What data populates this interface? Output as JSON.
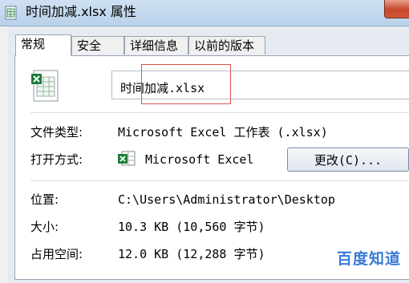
{
  "window": {
    "title": "时间加减.xlsx 属性"
  },
  "tabs": [
    {
      "label": "常规"
    },
    {
      "label": "安全"
    },
    {
      "label": "详细信息"
    },
    {
      "label": "以前的版本"
    }
  ],
  "general": {
    "file_name": "时间加减.xlsx",
    "file_type": {
      "label": "文件类型:",
      "value": "Microsoft Excel 工作表 (.xlsx)"
    },
    "open_with": {
      "label": "打开方式:",
      "value": "Microsoft Excel",
      "change_button": "更改(C)..."
    },
    "location": {
      "label": "位置:",
      "value": "C:\\Users\\Administrator\\Desktop"
    },
    "size": {
      "label": "大小:",
      "value": "10.3 KB (10,560 字节)"
    },
    "size_on_disk": {
      "label": "占用空间:",
      "value": "12.0 KB (12,288 字节)"
    }
  },
  "watermark": "百度知道",
  "colors": {
    "accent_blue": "#3a7bd5",
    "close_red": "#c6452a",
    "highlight_box": "#d9534f",
    "excel_green": "#1f7a3a"
  },
  "icons": {
    "title": "excel-file-icon",
    "file": "excel-spreadsheet-icon",
    "open_with": "excel-app-icon",
    "close": "close-icon"
  }
}
